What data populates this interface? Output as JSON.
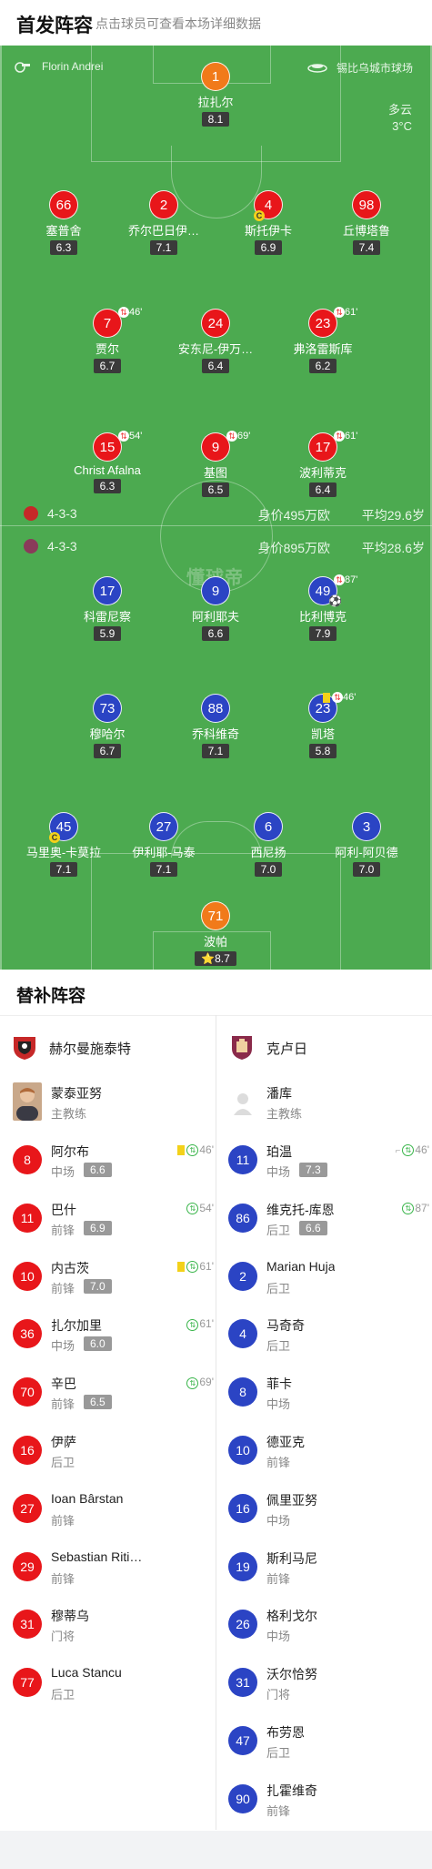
{
  "header": {
    "title": "首发阵容",
    "subtitle": "点击球员可查看本场详细数据"
  },
  "pitch": {
    "referee": "Florin Andrei",
    "stadium": "锡比乌城市球场",
    "weather": "多云",
    "temperature": "3°C",
    "watermark": "懂球帝"
  },
  "home_formation": {
    "formation": "4-3-3",
    "value": "身价495万欧",
    "avg_age": "平均29.6岁",
    "color": "#e8161a"
  },
  "away_formation": {
    "formation": "4-3-3",
    "value": "身价895万欧",
    "avg_age": "平均28.6岁",
    "color": "#2b44c4"
  },
  "home_players": [
    {
      "num": "1",
      "name": "拉扎尔",
      "rating": "8.1",
      "color": "orange"
    },
    {
      "num": "66",
      "name": "塞普舍",
      "rating": "6.3",
      "color": "red"
    },
    {
      "num": "2",
      "name": "乔尔巴日伊…",
      "rating": "7.1",
      "color": "red"
    },
    {
      "num": "4",
      "name": "斯托伊卡",
      "rating": "6.9",
      "color": "red",
      "captain": "C"
    },
    {
      "num": "98",
      "name": "丘博塔鲁",
      "rating": "7.4",
      "color": "red"
    },
    {
      "num": "7",
      "name": "贾尔",
      "rating": "6.7",
      "color": "red",
      "sub": "46'"
    },
    {
      "num": "24",
      "name": "安东尼-伊万…",
      "rating": "6.4",
      "color": "red"
    },
    {
      "num": "23",
      "name": "弗洛雷斯库",
      "rating": "6.2",
      "color": "red",
      "sub": "61'"
    },
    {
      "num": "15",
      "name": "Christ Afalna",
      "rating": "6.3",
      "color": "red",
      "sub": "54'"
    },
    {
      "num": "9",
      "name": "基图",
      "rating": "6.5",
      "color": "red",
      "sub": "69'"
    },
    {
      "num": "17",
      "name": "波利蒂克",
      "rating": "6.4",
      "color": "red",
      "sub": "61'"
    }
  ],
  "away_players": [
    {
      "num": "17",
      "name": "科雷尼察",
      "rating": "5.9",
      "color": "blue"
    },
    {
      "num": "9",
      "name": "阿利耶夫",
      "rating": "6.6",
      "color": "blue"
    },
    {
      "num": "49",
      "name": "比利博克",
      "rating": "7.9",
      "color": "blue",
      "sub": "87'",
      "goal": "⚽"
    },
    {
      "num": "73",
      "name": "穆哈尔",
      "rating": "6.7",
      "color": "blue"
    },
    {
      "num": "88",
      "name": "乔科维奇",
      "rating": "7.1",
      "color": "blue"
    },
    {
      "num": "23",
      "name": "凯塔",
      "rating": "5.8",
      "color": "blue",
      "sub": "46'",
      "yellow": true
    },
    {
      "num": "45",
      "name": "马里奥-卡莫拉",
      "rating": "7.1",
      "color": "blue",
      "captain": "C"
    },
    {
      "num": "27",
      "name": "伊利耶-马泰",
      "rating": "7.1",
      "color": "blue"
    },
    {
      "num": "6",
      "name": "西尼扬",
      "rating": "7.0",
      "color": "blue"
    },
    {
      "num": "3",
      "name": "阿利-阿贝德",
      "rating": "7.0",
      "color": "blue"
    },
    {
      "num": "71",
      "name": "波帕",
      "rating": "8.7",
      "color": "orange",
      "star": "⭐"
    }
  ],
  "subs": {
    "title": "替补阵容",
    "home_team": "赫尔曼施泰特",
    "away_team": "克卢日",
    "home_coach": {
      "name": "蒙泰亚努",
      "role": "主教练"
    },
    "away_coach": {
      "name": "潘库",
      "role": "主教练"
    },
    "home": [
      {
        "num": "8",
        "name": "阿尔布",
        "pos": "中场",
        "rating": "6.6",
        "event": "46'",
        "yellow": true
      },
      {
        "num": "11",
        "name": "巴什",
        "pos": "前锋",
        "rating": "6.9",
        "event": "54'"
      },
      {
        "num": "10",
        "name": "内古茨",
        "pos": "前锋",
        "rating": "7.0",
        "event": "61'",
        "yellow": true
      },
      {
        "num": "36",
        "name": "扎尔加里",
        "pos": "中场",
        "rating": "6.0",
        "event": "61'"
      },
      {
        "num": "70",
        "name": "辛巴",
        "pos": "前锋",
        "rating": "6.5",
        "event": "69'"
      },
      {
        "num": "16",
        "name": "伊萨",
        "pos": "后卫"
      },
      {
        "num": "27",
        "name": "Ioan Bârstan",
        "pos": "前锋"
      },
      {
        "num": "29",
        "name": "Sebastian Riti…",
        "pos": "前锋"
      },
      {
        "num": "31",
        "name": "穆蒂乌",
        "pos": "门将"
      },
      {
        "num": "77",
        "name": "Luca Stancu",
        "pos": "后卫"
      }
    ],
    "away": [
      {
        "num": "11",
        "name": "珀温",
        "pos": "中场",
        "rating": "7.3",
        "event": "46'",
        "assist": true
      },
      {
        "num": "86",
        "name": "维克托-库恩",
        "pos": "后卫",
        "rating": "6.6",
        "event": "87'"
      },
      {
        "num": "2",
        "name": "Marian Huja",
        "pos": "后卫"
      },
      {
        "num": "4",
        "name": "马奇奇",
        "pos": "后卫"
      },
      {
        "num": "8",
        "name": "菲卡",
        "pos": "中场"
      },
      {
        "num": "10",
        "name": "德亚克",
        "pos": "前锋"
      },
      {
        "num": "16",
        "name": "佩里亚努",
        "pos": "中场"
      },
      {
        "num": "19",
        "name": "斯利马尼",
        "pos": "前锋"
      },
      {
        "num": "26",
        "name": "格利戈尔",
        "pos": "中场"
      },
      {
        "num": "31",
        "name": "沃尔恰努",
        "pos": "门将"
      },
      {
        "num": "47",
        "name": "布劳恩",
        "pos": "后卫"
      },
      {
        "num": "90",
        "name": "扎霍维奇",
        "pos": "前锋"
      }
    ]
  }
}
